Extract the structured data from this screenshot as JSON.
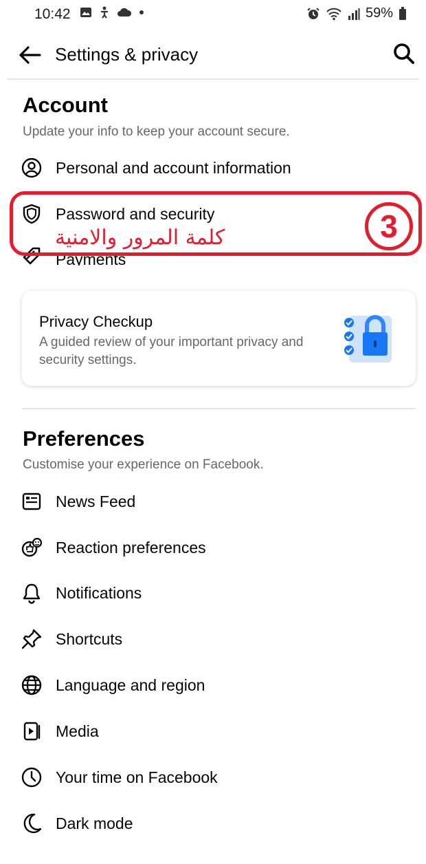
{
  "status_bar": {
    "time": "10:42",
    "battery": "59%"
  },
  "header": {
    "title": "Settings & privacy"
  },
  "account": {
    "title": "Account",
    "subtitle": "Update your info to keep your account secure.",
    "items": [
      {
        "label": "Personal and account information",
        "icon": "person-circle-icon"
      },
      {
        "label": "Password and security",
        "icon": "shield-icon"
      },
      {
        "label": "Payments",
        "icon": "tag-icon"
      }
    ]
  },
  "privacy_card": {
    "title": "Privacy Checkup",
    "description": "A guided review of your important privacy and security settings."
  },
  "annotation": {
    "arabic_text": "كلمة المرور والامنية",
    "step": "3",
    "color": "#e11d2e"
  },
  "preferences": {
    "title": "Preferences",
    "subtitle": "Customise your experience on Facebook.",
    "items": [
      {
        "label": "News Feed",
        "icon": "news-feed-icon"
      },
      {
        "label": "Reaction preferences",
        "icon": "reaction-icon"
      },
      {
        "label": "Notifications",
        "icon": "bell-icon"
      },
      {
        "label": "Shortcuts",
        "icon": "pin-icon"
      },
      {
        "label": "Language and region",
        "icon": "globe-icon"
      },
      {
        "label": "Media",
        "icon": "media-icon"
      },
      {
        "label": "Your time on Facebook",
        "icon": "clock-icon"
      },
      {
        "label": "Dark mode",
        "icon": "moon-icon"
      }
    ]
  }
}
